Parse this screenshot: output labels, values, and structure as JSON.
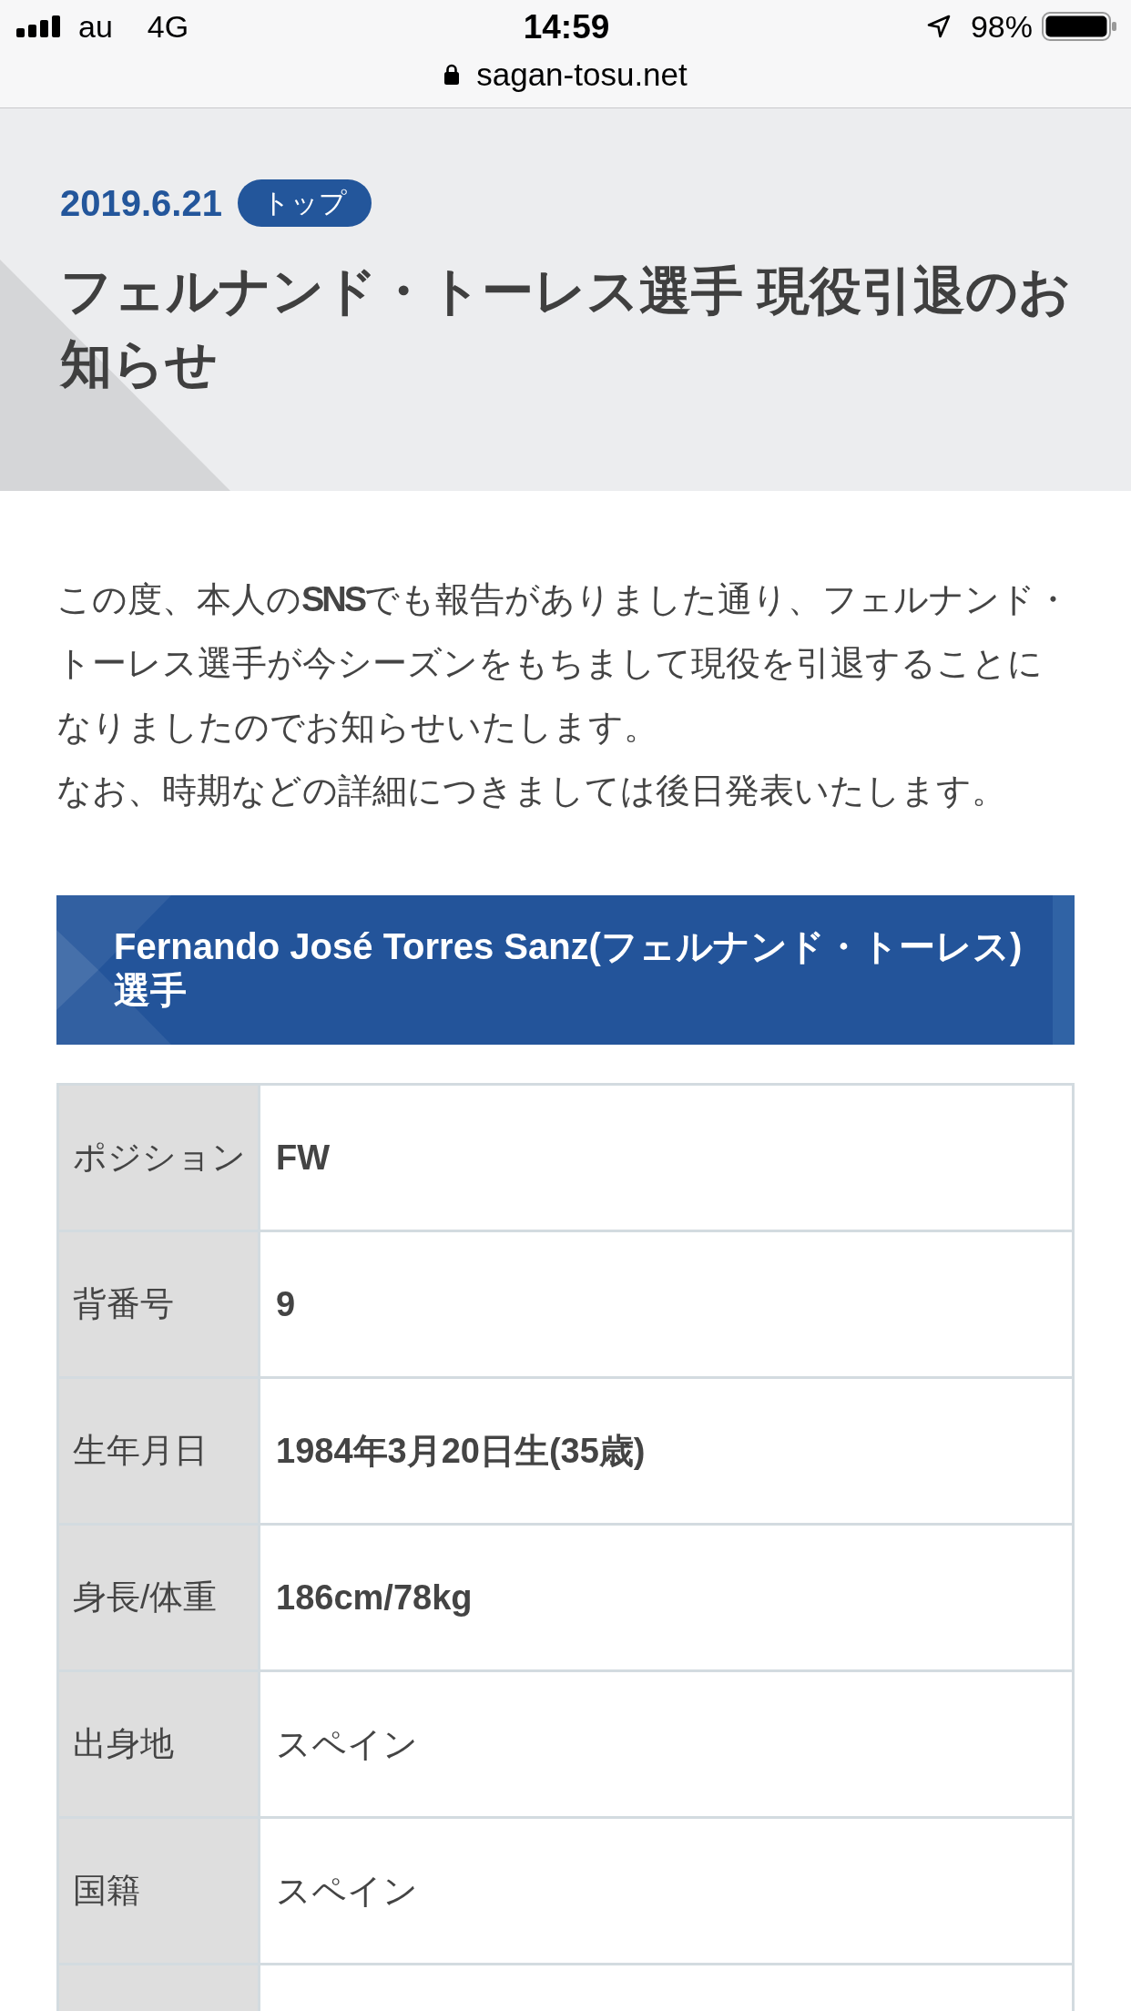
{
  "status_bar": {
    "carrier": "au",
    "network": "4G",
    "time": "14:59",
    "battery": "98%",
    "url": "sagan-tosu.net"
  },
  "article": {
    "date": "2019.6.21",
    "category": "トップ",
    "title": "フェルナンド・トーレス選手 現役引退のお知らせ",
    "paragraphs": [
      "この度、本人の**SNS**でも報告がありました通り、フェルナンド・トーレス選手が今シーズンをもちまして現役を引退することになりましたのでお知らせいたします。",
      "なお、時期などの詳細につきましては後日発表いたします。"
    ]
  },
  "profile": {
    "heading": "Fernando José Torres Sanz(フェルナンド・トーレス)選手",
    "rows": [
      {
        "label": "ポジション",
        "value": "FW",
        "bold": true
      },
      {
        "label": "背番号",
        "value": "9",
        "bold": true
      },
      {
        "label": "生年月日",
        "value": "1984年3月20日生(35歳)",
        "bold": true
      },
      {
        "label": "身長/体重",
        "value": "186cm/78kg",
        "bold": true
      },
      {
        "label": "出身地",
        "value": "スペイン",
        "bold": false
      },
      {
        "label": "国籍",
        "value": "スペイン",
        "bold": false
      }
    ]
  }
}
